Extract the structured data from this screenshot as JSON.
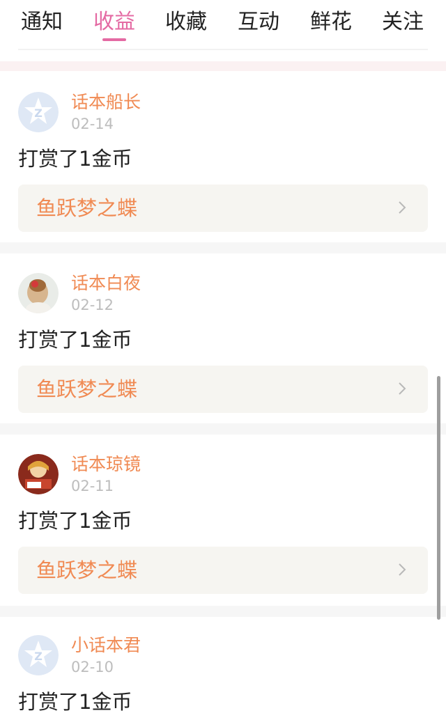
{
  "tabs": [
    {
      "label": "通知"
    },
    {
      "label": "收益"
    },
    {
      "label": "收藏"
    },
    {
      "label": "互动"
    },
    {
      "label": "鲜花"
    },
    {
      "label": "关注"
    }
  ],
  "active_tab": "收益",
  "colors": {
    "accent_pink": "#e46aa3",
    "username_orange": "#f08a53",
    "book_bg": "#f6f5f1",
    "date_gray": "#bdbdbd"
  },
  "feed": [
    {
      "user": "话本船长",
      "date": "02-14",
      "message": "打赏了1金币",
      "book": "鱼跃梦之蝶",
      "avatar": "default-star-avatar"
    },
    {
      "user": "话本白夜",
      "date": "02-12",
      "message": "打赏了1金币",
      "book": "鱼跃梦之蝶",
      "avatar": "photo-avatar-girl"
    },
    {
      "user": "话本琼镜",
      "date": "02-11",
      "message": "打赏了1金币",
      "book": "鱼跃梦之蝶",
      "avatar": "illustrated-avatar"
    },
    {
      "user": "小话本君",
      "date": "02-10",
      "message": "打赏了1金币",
      "book": "",
      "avatar": "default-star-avatar"
    }
  ]
}
